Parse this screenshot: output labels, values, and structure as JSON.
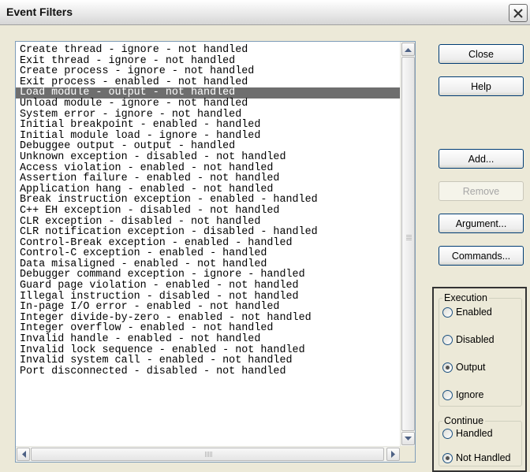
{
  "window": {
    "title": "Event Filters",
    "close_glyph": "✕"
  },
  "events": [
    "Create thread - ignore - not handled",
    "Exit thread - ignore - not handled",
    "Create process - ignore - not handled",
    "Exit process - enabled - not handled",
    "Load module - output - not handled",
    "Unload module - ignore - not handled",
    "System error - ignore - not handled",
    "Initial breakpoint - enabled - handled",
    "Initial module load - ignore - handled",
    "Debuggee output - output - handled",
    "Unknown exception - disabled - not handled",
    "Access violation - enabled - not handled",
    "Assertion failure - enabled - not handled",
    "Application hang - enabled - not handled",
    "Break instruction exception - enabled - handled",
    "C++ EH exception - disabled - not handled",
    "CLR exception - disabled - not handled",
    "CLR notification exception - disabled - handled",
    "Control-Break exception - enabled - handled",
    "Control-C exception - enabled - handled",
    "Data misaligned - enabled - not handled",
    "Debugger command exception - ignore - handled",
    "Guard page violation - enabled - not handled",
    "Illegal instruction - disabled - not handled",
    "In-page I/O error - enabled - not handled",
    "Integer divide-by-zero - enabled - not handled",
    "Integer overflow - enabled - not handled",
    "Invalid handle - enabled - not handled",
    "Invalid lock sequence - enabled - not handled",
    "Invalid system call - enabled - not handled",
    "Port disconnected - disabled - not handled"
  ],
  "selected_index": 4,
  "buttons": {
    "close": "Close",
    "help": "Help",
    "add": "Add...",
    "remove": "Remove",
    "argument": "Argument...",
    "commands": "Commands..."
  },
  "execution": {
    "title": "Execution",
    "options": [
      "Enabled",
      "Disabled",
      "Output",
      "Ignore"
    ],
    "selected": "Output"
  },
  "continue": {
    "title": "Continue",
    "options": [
      "Handled",
      "Not Handled"
    ],
    "selected": "Not Handled"
  },
  "colors": {
    "selection_bg": "#6e6e6e",
    "dialog_bg": "#ece9d8"
  }
}
